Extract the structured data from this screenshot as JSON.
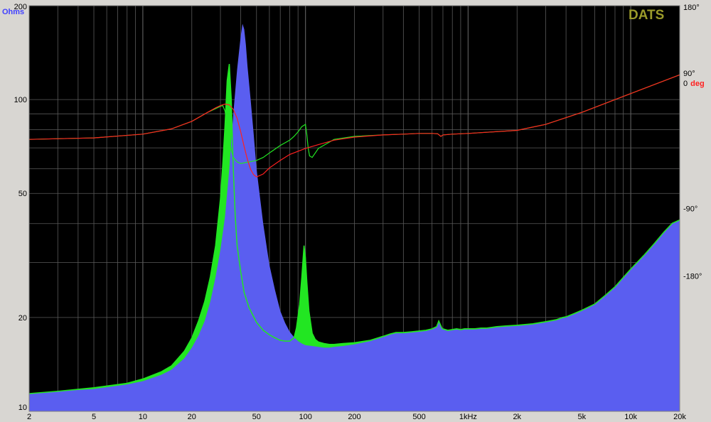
{
  "chart_data": {
    "type": "area",
    "y_unit": "Ohms",
    "y2_unit": "deg",
    "brand": "DATS",
    "x_scale": "log",
    "y_scale": "log",
    "xlim": [
      2,
      20000
    ],
    "ylim": [
      10,
      200
    ],
    "y2lim": [
      -360,
      180
    ],
    "grid": true,
    "x_ticks": [
      {
        "v": 2,
        "label": "2"
      },
      {
        "v": 5,
        "label": "5"
      },
      {
        "v": 10,
        "label": "10"
      },
      {
        "v": 20,
        "label": "20"
      },
      {
        "v": 50,
        "label": "50"
      },
      {
        "v": 100,
        "label": "100"
      },
      {
        "v": 200,
        "label": "200"
      },
      {
        "v": 500,
        "label": "500"
      },
      {
        "v": 1000,
        "label": "1kHz"
      },
      {
        "v": 2000,
        "label": "2k"
      },
      {
        "v": 5000,
        "label": "5k"
      },
      {
        "v": 10000,
        "label": "10k"
      },
      {
        "v": 20000,
        "label": "20k"
      }
    ],
    "y_ticks": [
      {
        "v": 200,
        "label": "200"
      },
      {
        "v": 100,
        "label": "100"
      },
      {
        "v": 50,
        "label": "50"
      },
      {
        "v": 20,
        "label": "20"
      },
      {
        "v": 10,
        "label": "10"
      }
    ],
    "y2_ticks": [
      {
        "v": 180,
        "label": "180°"
      },
      {
        "v": 90,
        "label": "90°"
      },
      {
        "v": -90,
        "label": "-90°"
      },
      {
        "v": -180,
        "label": "-180°"
      }
    ],
    "y2_zero_label": {
      "num": "0",
      "unit": "deg"
    },
    "colors": {
      "background": "#000000",
      "grid": "#5a5a5a",
      "impedance_blue": "#5a5ef0",
      "impedance_green": "#22e622",
      "phase_red": "#ff2020",
      "phase_green": "#22e622",
      "ohms_label": "#4040ff",
      "deg_label": "#ff2020",
      "brand": "#9a9a2a"
    },
    "series": [
      {
        "kind": "impedance",
        "color": "blue",
        "x": [
          2,
          3,
          5,
          8,
          10,
          13,
          15,
          18,
          20,
          22,
          24,
          26,
          28,
          30,
          32,
          34,
          36,
          38,
          40,
          41,
          42,
          43,
          44,
          46,
          48,
          50,
          55,
          60,
          65,
          70,
          75,
          80,
          85,
          90,
          95,
          100,
          110,
          120,
          130,
          140,
          150,
          170,
          200,
          250,
          300,
          330,
          360,
          400,
          450,
          500,
          550,
          600,
          640,
          660,
          690,
          700,
          750,
          800,
          850,
          900,
          950,
          1000,
          1100,
          1200,
          1300,
          1400,
          1500,
          1700,
          2000,
          2500,
          3000,
          3500,
          3800,
          4000,
          4500,
          5000,
          6000,
          7000,
          8000,
          9000,
          10000,
          12000,
          14000,
          16000,
          18000,
          20000
        ],
        "y": [
          11.4,
          11.6,
          11.8,
          12.2,
          12.5,
          13.1,
          13.6,
          14.8,
          16.0,
          17.5,
          19.5,
          22.5,
          27,
          33,
          42,
          60,
          90,
          125,
          160,
          175,
          168,
          150,
          128,
          100,
          78,
          60,
          40,
          29.5,
          24.5,
          21,
          19.2,
          18.0,
          17.3,
          16.8,
          16.5,
          16.3,
          16.2,
          16.1,
          16.0,
          16.0,
          16.1,
          16.2,
          16.4,
          16.8,
          17.3,
          17.6,
          17.8,
          17.8,
          17.9,
          18.0,
          18.1,
          18.3,
          18.6,
          19.4,
          18.4,
          18.3,
          18.1,
          18.2,
          18.3,
          18.2,
          18.3,
          18.3,
          18.3,
          18.4,
          18.4,
          18.5,
          18.6,
          18.7,
          18.8,
          19.0,
          19.3,
          19.6,
          19.9,
          20.0,
          20.5,
          21.0,
          22.0,
          23.5,
          25.0,
          26.8,
          28.5,
          31.5,
          34.5,
          37.5,
          40,
          41
        ]
      },
      {
        "kind": "impedance",
        "color": "green",
        "x": [
          2,
          3,
          5,
          8,
          10,
          13,
          15,
          18,
          20,
          22,
          24,
          26,
          28,
          30,
          31,
          32,
          33,
          34,
          35,
          36,
          37,
          38,
          40,
          42,
          45,
          50,
          55,
          60,
          65,
          70,
          75,
          80,
          85,
          88,
          92,
          95,
          98,
          100,
          102,
          105,
          110,
          115,
          120,
          130,
          140,
          150,
          170,
          200,
          250,
          300,
          330,
          360,
          400,
          450,
          500,
          550,
          600,
          640,
          660,
          690,
          700,
          750,
          800,
          850,
          900,
          950,
          1000,
          1100,
          1200,
          1300,
          1400,
          1500,
          1700,
          2000,
          2500,
          3000,
          3500,
          3800,
          4000,
          4500,
          5000,
          6000,
          7000,
          8000,
          9000,
          10000,
          12000,
          14000,
          16000,
          18000,
          20000
        ],
        "y": [
          11.4,
          11.6,
          11.9,
          12.3,
          12.7,
          13.4,
          14.0,
          15.6,
          17.2,
          19.5,
          22.5,
          27,
          34,
          48,
          62,
          82,
          115,
          130,
          100,
          60,
          42,
          34,
          28,
          24,
          21.5,
          19.3,
          18.2,
          17.6,
          17.2,
          16.9,
          16.8,
          16.8,
          17.2,
          18.5,
          22,
          27,
          34,
          31,
          26,
          21,
          17.8,
          17.0,
          16.7,
          16.5,
          16.4,
          16.4,
          16.5,
          16.6,
          16.9,
          17.4,
          17.7,
          17.9,
          17.9,
          18.0,
          18.1,
          18.2,
          18.4,
          18.7,
          19.5,
          18.5,
          18.4,
          18.2,
          18.3,
          18.4,
          18.3,
          18.4,
          18.4,
          18.4,
          18.5,
          18.5,
          18.6,
          18.7,
          18.8,
          18.9,
          19.1,
          19.4,
          19.7,
          20.0,
          20.1,
          20.6,
          21.1,
          22.1,
          23.6,
          25.1,
          26.9,
          28.6,
          31.6,
          34.6,
          37.6,
          40.1,
          41.1
        ]
      },
      {
        "kind": "phase",
        "color": "red",
        "x": [
          2,
          5,
          10,
          15,
          20,
          25,
          28,
          30,
          32,
          34,
          36,
          38,
          40,
          42,
          44,
          46,
          48,
          50,
          55,
          60,
          70,
          80,
          100,
          120,
          150,
          200,
          300,
          400,
          500,
          600,
          650,
          680,
          700,
          800,
          1000,
          2000,
          3000,
          5000,
          10000,
          20000
        ],
        "y": [
          2,
          4,
          9,
          16,
          26,
          38,
          44,
          47,
          49,
          48,
          42,
          30,
          12,
          -8,
          -25,
          -38,
          -45,
          -48,
          -44,
          -36,
          -26,
          -18,
          -10,
          -5,
          1,
          5,
          8,
          9,
          10,
          10,
          9.5,
          6,
          8,
          9,
          10,
          14,
          22,
          38,
          63,
          88
        ]
      },
      {
        "kind": "phase",
        "color": "green",
        "x": [
          2,
          5,
          10,
          15,
          20,
          25,
          28,
          30,
          31,
          32,
          33,
          34,
          35,
          36,
          38,
          40,
          45,
          50,
          55,
          60,
          70,
          80,
          85,
          90,
          95,
          100,
          102,
          104,
          106,
          110,
          120,
          150,
          200,
          300,
          400,
          500,
          600,
          650,
          680,
          700,
          800,
          1000,
          2000,
          3000,
          5000,
          10000,
          20000
        ],
        "y": [
          2,
          4,
          9,
          16,
          26,
          38,
          43,
          46,
          47,
          40,
          22,
          4,
          -12,
          -22,
          -28,
          -30,
          -28,
          -26,
          -22,
          -16,
          -6,
          1,
          6,
          12,
          19,
          22,
          8,
          -10,
          -20,
          -22,
          -10,
          2,
          6,
          8,
          9,
          10,
          10,
          9.5,
          6,
          8,
          9,
          10,
          14,
          22,
          38,
          63,
          88
        ]
      }
    ]
  }
}
